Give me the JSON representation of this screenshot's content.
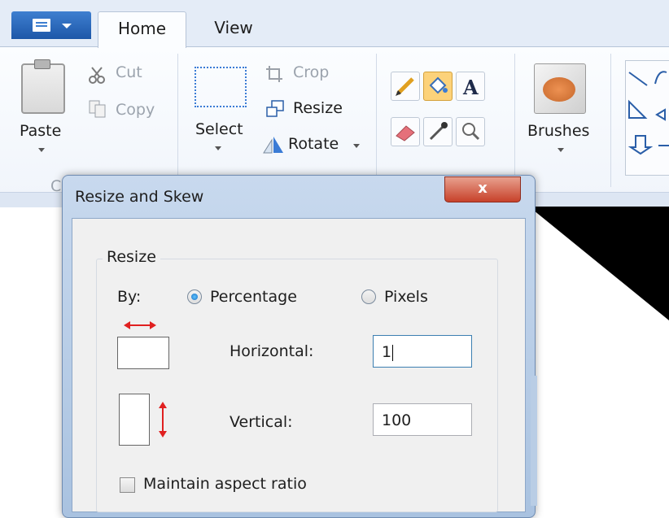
{
  "ribbon": {
    "tabs": [
      {
        "label": "Home"
      },
      {
        "label": "View"
      }
    ],
    "clipboard": {
      "paste": "Paste",
      "cut": "Cut",
      "copy": "Copy",
      "group_label_fragment": "C"
    },
    "image": {
      "select": "Select",
      "crop": "Crop",
      "resize": "Resize",
      "rotate": "Rotate"
    },
    "brushes": "Brushes"
  },
  "dialog": {
    "title": "Resize and Skew",
    "close_glyph": "x",
    "resize_group": {
      "legend": "Resize",
      "by_label": "By:",
      "options": [
        {
          "label": "Percentage",
          "selected": true
        },
        {
          "label": "Pixels",
          "selected": false
        }
      ],
      "horizontal": {
        "label": "Horizontal:",
        "value": "1"
      },
      "vertical": {
        "label": "Vertical:",
        "value": "100"
      },
      "maintain_aspect": {
        "label": "Maintain aspect ratio",
        "checked": false
      }
    }
  },
  "colors": {
    "accent": "#1d57a8",
    "close": "#c7412a",
    "arrow": "#e02020",
    "highlight": "#fcd27a"
  }
}
